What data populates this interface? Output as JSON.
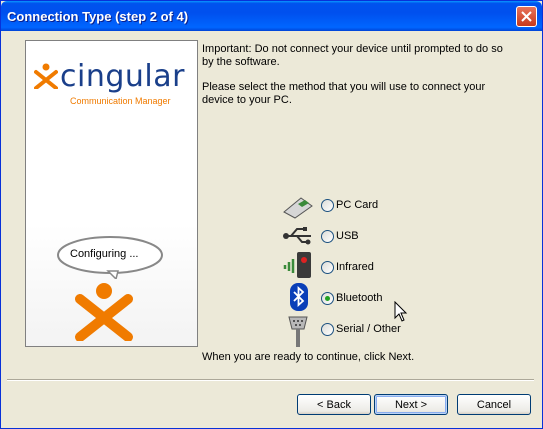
{
  "window": {
    "title": "Connection Type (step 2 of 4)"
  },
  "brand": {
    "logo_word": "cingular",
    "logo_sub": "Communication Manager",
    "bubble": "Configuring ..."
  },
  "content": {
    "important": "Important:  Do not connect your device until prompted to do so by the software.",
    "instruction": "Please select the method that you will use to connect your device to your PC.",
    "options": [
      {
        "label": "PC Card",
        "icon": "pc-card-icon",
        "selected": false
      },
      {
        "label": "USB",
        "icon": "usb-icon",
        "selected": false
      },
      {
        "label": "Infrared",
        "icon": "infrared-icon",
        "selected": false
      },
      {
        "label": "Bluetooth",
        "icon": "bluetooth-icon",
        "selected": true
      },
      {
        "label": "Serial / Other",
        "icon": "serial-icon",
        "selected": false
      }
    ],
    "footer": "When you are ready to continue, click Next."
  },
  "buttons": {
    "back": "< Back",
    "next": "Next >",
    "cancel": "Cancel"
  },
  "colors": {
    "title_bar": "#0054e3",
    "accent_orange": "#f07b00",
    "radio_selected": "#21a121"
  }
}
